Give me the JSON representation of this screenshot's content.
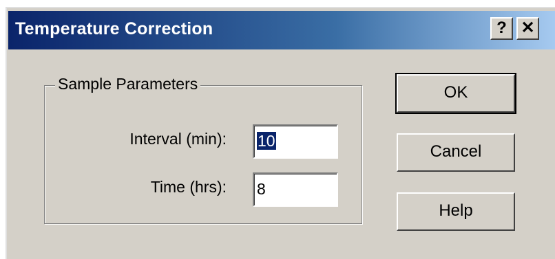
{
  "window": {
    "title": "Temperature Correction",
    "help_glyph": "?",
    "close_glyph": "✕"
  },
  "group": {
    "legend": "Sample Parameters"
  },
  "fields": {
    "interval_label": "Interval (min):",
    "interval_value": "10",
    "time_label": "Time (hrs):",
    "time_value": "8"
  },
  "buttons": {
    "ok_label": "OK",
    "cancel_label": "Cancel",
    "help_label": "Help"
  },
  "colors": {
    "titlebar_start": "#0a246a",
    "titlebar_end": "#a6caf0",
    "face": "#d4d0c8",
    "selection": "#0a246a"
  }
}
